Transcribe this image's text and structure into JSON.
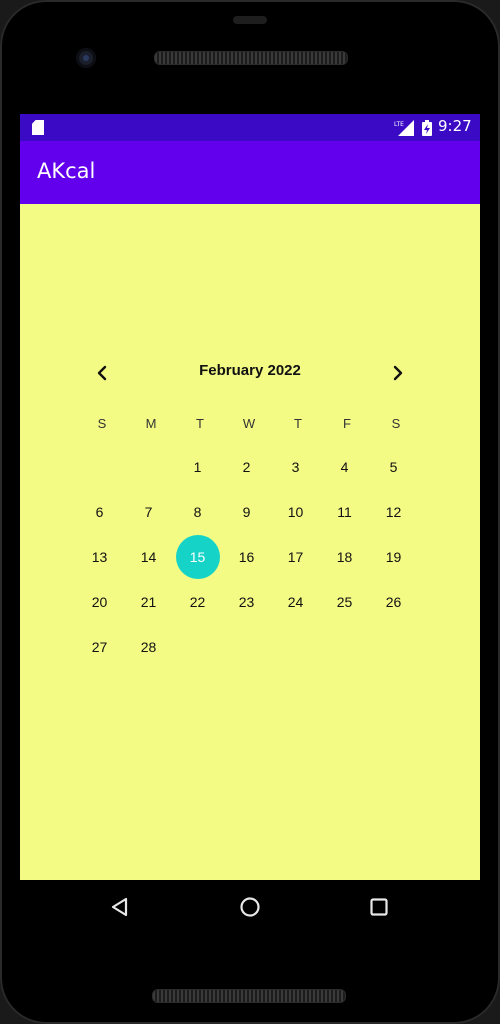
{
  "status_bar": {
    "time": "9:27",
    "network": "LTE",
    "icons": [
      "sd-card-icon",
      "signal-icon",
      "battery-icon"
    ]
  },
  "app_bar": {
    "title": "AKcal"
  },
  "calendar": {
    "month_label": "February 2022",
    "prev_icon": "chevron-left-icon",
    "next_icon": "chevron-right-icon",
    "weekdays": [
      "S",
      "M",
      "T",
      "W",
      "T",
      "F",
      "S"
    ],
    "first_day_column": 2,
    "days": [
      "1",
      "2",
      "3",
      "4",
      "5",
      "6",
      "7",
      "8",
      "9",
      "10",
      "11",
      "12",
      "13",
      "14",
      "15",
      "16",
      "17",
      "18",
      "19",
      "20",
      "21",
      "22",
      "23",
      "24",
      "25",
      "26",
      "27",
      "28"
    ],
    "selected_day": "15",
    "selected_color": "#16d3c7"
  },
  "colors": {
    "status_bar": "#3a0ac5",
    "app_bar": "#6200ee",
    "background": "#f4fb85"
  },
  "system_nav": {
    "buttons": [
      "back-icon",
      "home-icon",
      "recent-apps-icon"
    ]
  }
}
